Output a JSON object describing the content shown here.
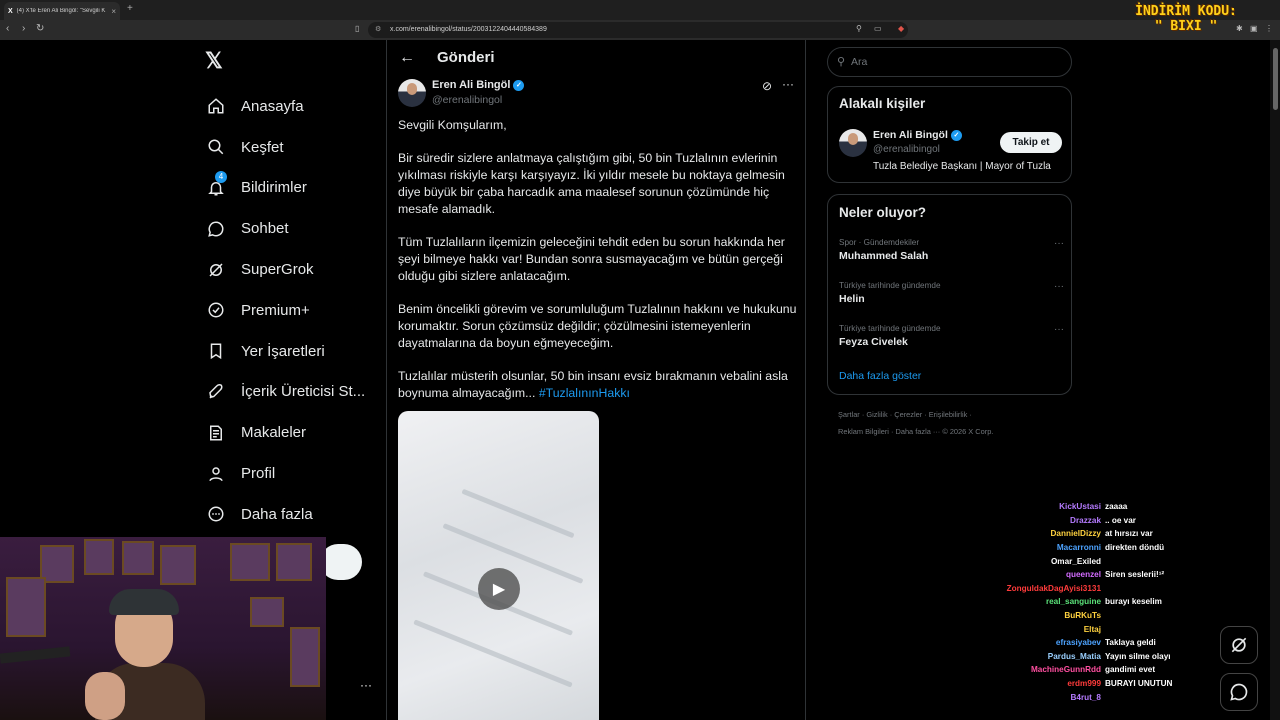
{
  "browser": {
    "tab_title": "(4) X'te Eren Ali Bingöl: \"Sevgili K",
    "tab_favicon": "X",
    "url": "x.com/erenalibingol/status/2003122404440584389"
  },
  "promo": {
    "line1": "İNDİRİM KODU:",
    "line2": "\" BIXI \""
  },
  "x_logo": "𝕏",
  "nav": {
    "items": [
      {
        "label": "Anasayfa",
        "icon": "home-icon",
        "glyph": "⌂"
      },
      {
        "label": "Keşfet",
        "icon": "search-icon",
        "glyph": "⚲"
      },
      {
        "label": "Bildirimler",
        "icon": "bell-icon",
        "glyph": "🔔︎",
        "badge": "4"
      },
      {
        "label": "Sohbet",
        "icon": "chat-icon",
        "glyph": "💬︎"
      },
      {
        "label": "SuperGrok",
        "icon": "grok-icon",
        "glyph": "⊘"
      },
      {
        "label": "Premium+",
        "icon": "premium-icon",
        "glyph": "✓"
      },
      {
        "label": "Yer İşaretleri",
        "icon": "bookmark-icon",
        "glyph": "🔖︎"
      },
      {
        "label": "İçerik Üreticisi St...",
        "icon": "rocket-icon",
        "glyph": "🚀︎"
      },
      {
        "label": "Makaleler",
        "icon": "article-icon",
        "glyph": "✎"
      },
      {
        "label": "Profil",
        "icon": "person-icon",
        "glyph": "👤︎"
      },
      {
        "label": "Daha fazla",
        "icon": "more-circle-icon",
        "glyph": "⋯"
      }
    ]
  },
  "main": {
    "header_title": "Gönderi",
    "author": {
      "name": "Eren Ali Bingöl",
      "handle": "@erenalibingol"
    },
    "paragraphs": [
      "Sevgili Komşularım,",
      "Bir süredir sizlere anlatmaya çalıştığım gibi, 50 bin Tuzlalının evlerinin yıkılması riskiyle karşı karşıyayız. İki yıldır mesele bu noktaya gelmesin diye büyük bir çaba harcadık ama maalesef sorunun çözümünde hiç mesafe alamadık.",
      "Tüm Tuzlalıların ilçemizin geleceğini tehdit eden bu sorun hakkında her şeyi bilmeye hakkı var! Bundan sonra susmayacağım ve bütün gerçeği olduğu gibi sizlere anlatacağım.",
      "Benim öncelikli görevim ve sorumluluğum Tuzlalının hakkını ve hukukunu korumaktır. Sorun çözümsüz değildir; çözülmesini istemeyenlerin dayatmalarına da boyun eğmeyeceğim."
    ],
    "last_paragraph": "Tuzlalılar müsterih olsunlar, 50 bin insanı evsiz bırakmanın vebalini asla boynuma almayacağım...",
    "hashtag": "#TuzlalınınHakkı"
  },
  "right": {
    "search_placeholder": "Ara",
    "related": {
      "title": "Alakalı kişiler",
      "name": "Eren Ali Bingöl",
      "handle": "@erenalibingol",
      "bio": "Tuzla Belediye Başkanı | Mayor of Tuzla",
      "follow_label": "Takip et"
    },
    "trends": {
      "title": "Neler oluyor?",
      "items": [
        {
          "meta": "Spor · Gündemdekiler",
          "name": "Muhammed Salah"
        },
        {
          "meta": "Türkiye tarihinde gündemde",
          "name": "Helin"
        },
        {
          "meta": "Türkiye tarihinde gündemde",
          "name": "Feyza Civelek"
        }
      ],
      "show_more": "Daha fazla göster"
    },
    "footer_line1": "Şartlar  ·  Gizlilik  ·  Çerezler  ·  Erişilebilirlik  ·",
    "footer_line2": "Reklam Bilgileri  ·  Daha fazla ···  © 2026 X Corp."
  },
  "chat": [
    {
      "user": "KickUstasi",
      "color": "#b57bff",
      "msg": "zaaaa"
    },
    {
      "user": "Drazzak",
      "color": "#b57bff",
      "msg": ".. oe var"
    },
    {
      "user": "DannielDizzy",
      "color": "#ffd23f",
      "msg": "at hırsızı var"
    },
    {
      "user": "Macarronni",
      "color": "#4da3ff",
      "msg": "direkten döndü"
    },
    {
      "user": "Omar_Exiled",
      "color": "#ffffff",
      "msg": ""
    },
    {
      "user": "queenzel",
      "color": "#d36cff",
      "msg": "Siren seslerii!¹²"
    },
    {
      "user": "ZonguldakDagAyisi3131",
      "color": "#ff3b3b",
      "msg": ""
    },
    {
      "user": "real_sanguine",
      "color": "#5be37a",
      "msg": "burayı keselim"
    },
    {
      "user": "BuRKuTs",
      "color": "#ffd23f",
      "msg": ""
    },
    {
      "user": "Eltaj",
      "color": "#ffd23f",
      "msg": ""
    },
    {
      "user": "efrasiyabev",
      "color": "#4da3ff",
      "msg": "Taklaya geldi"
    },
    {
      "user": "Pardus_Matia",
      "color": "#9ad0ff",
      "msg": "Yayın silme olayı"
    },
    {
      "user": "MachineGunnRdd",
      "color": "#ff4fa0",
      "msg": "gandimi evet"
    },
    {
      "user": "erdm999",
      "color": "#ff3b3b",
      "msg": "BURAYI UNUTUN"
    },
    {
      "user": "B4rut_8",
      "color": "#b57bff",
      "msg": ""
    }
  ]
}
